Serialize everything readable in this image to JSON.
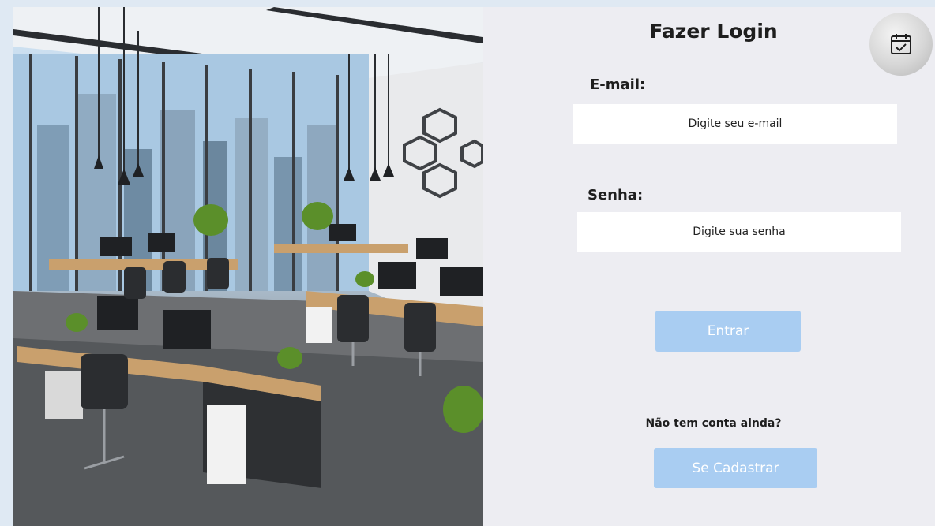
{
  "login": {
    "title": "Fazer Login",
    "email_label": "E-mail:",
    "email_placeholder": "Digite seu e-mail",
    "password_label": "Senha:",
    "password_placeholder": "Digite sua senha",
    "submit_label": "Entrar",
    "signup_prompt": "Não tem conta ainda?",
    "signup_label": "Se Cadastrar"
  },
  "icons": {
    "header_icon": "calendar-check-icon"
  },
  "colors": {
    "page_background": "#dfe9f3",
    "panel_background": "#ededf2",
    "button_background": "#a9cdf2",
    "text": "#1e1e1e"
  }
}
